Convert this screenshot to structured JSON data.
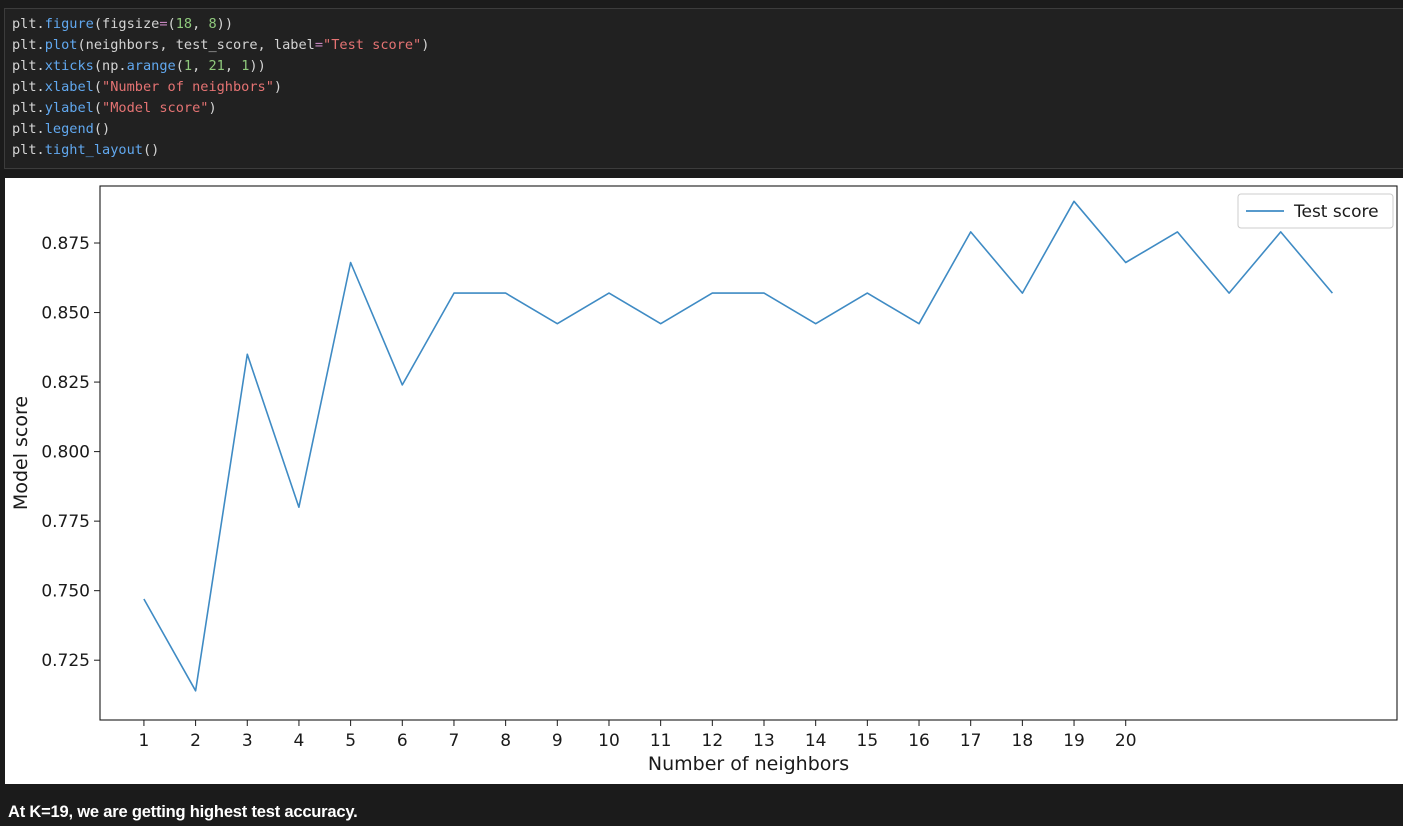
{
  "code_cell": {
    "lines": [
      [
        {
          "t": "plt.",
          "c": ""
        },
        {
          "t": "figure",
          "c": "fn"
        },
        {
          "t": "(figsize",
          "c": ""
        },
        {
          "t": "=",
          "c": "eq"
        },
        {
          "t": "(",
          "c": ""
        },
        {
          "t": "18",
          "c": "num"
        },
        {
          "t": ", ",
          "c": ""
        },
        {
          "t": "8",
          "c": "num"
        },
        {
          "t": "))",
          "c": ""
        }
      ],
      [
        {
          "t": "plt.",
          "c": ""
        },
        {
          "t": "plot",
          "c": "fn"
        },
        {
          "t": "(neighbors, test_score, label",
          "c": ""
        },
        {
          "t": "=",
          "c": "eq"
        },
        {
          "t": "\"Test score\"",
          "c": "str"
        },
        {
          "t": ")",
          "c": ""
        }
      ],
      [
        {
          "t": "plt.",
          "c": ""
        },
        {
          "t": "xticks",
          "c": "fn"
        },
        {
          "t": "(np.",
          "c": ""
        },
        {
          "t": "arange",
          "c": "fn"
        },
        {
          "t": "(",
          "c": ""
        },
        {
          "t": "1",
          "c": "num"
        },
        {
          "t": ", ",
          "c": ""
        },
        {
          "t": "21",
          "c": "num"
        },
        {
          "t": ", ",
          "c": ""
        },
        {
          "t": "1",
          "c": "num"
        },
        {
          "t": "))",
          "c": ""
        }
      ],
      [
        {
          "t": "plt.",
          "c": ""
        },
        {
          "t": "xlabel",
          "c": "fn"
        },
        {
          "t": "(",
          "c": ""
        },
        {
          "t": "\"Number of neighbors\"",
          "c": "str"
        },
        {
          "t": ")",
          "c": ""
        }
      ],
      [
        {
          "t": "plt.",
          "c": ""
        },
        {
          "t": "ylabel",
          "c": "fn"
        },
        {
          "t": "(",
          "c": ""
        },
        {
          "t": "\"Model score\"",
          "c": "str"
        },
        {
          "t": ")",
          "c": ""
        }
      ],
      [
        {
          "t": "plt.",
          "c": ""
        },
        {
          "t": "legend",
          "c": "fn"
        },
        {
          "t": "()",
          "c": ""
        }
      ],
      [
        {
          "t": "plt.",
          "c": ""
        },
        {
          "t": "tight_layout",
          "c": "fn"
        },
        {
          "t": "()",
          "c": ""
        }
      ]
    ]
  },
  "chart_data": {
    "type": "line",
    "title": "",
    "xlabel": "Number of neighbors",
    "ylabel": "Model score",
    "xlim": [
      0.15,
      25.25
    ],
    "ylim": [
      0.7035,
      0.8955
    ],
    "x_ticks": [
      1,
      2,
      3,
      4,
      5,
      6,
      7,
      8,
      9,
      10,
      11,
      12,
      13,
      14,
      15,
      16,
      17,
      18,
      19,
      20
    ],
    "y_ticks": [
      0.725,
      0.75,
      0.775,
      0.8,
      0.825,
      0.85,
      0.875
    ],
    "y_tick_labels": [
      "0.725",
      "0.750",
      "0.775",
      "0.800",
      "0.825",
      "0.850",
      "0.875"
    ],
    "grid": false,
    "legend_position": "top-right",
    "series": [
      {
        "name": "Test score",
        "color": "#3f8bc4",
        "x": [
          1,
          2,
          3,
          4,
          5,
          6,
          7,
          8,
          9,
          10,
          11,
          12,
          13,
          14,
          15,
          16,
          17,
          18,
          19,
          20,
          21,
          22,
          23,
          24
        ],
        "values": [
          0.747,
          0.714,
          0.835,
          0.78,
          0.868,
          0.824,
          0.857,
          0.857,
          0.846,
          0.857,
          0.846,
          0.857,
          0.857,
          0.846,
          0.857,
          0.846,
          0.879,
          0.857,
          0.89,
          0.868,
          0.879,
          0.857,
          0.879,
          0.857
        ]
      }
    ]
  },
  "markdown": {
    "text": "At K=19, we are getting highest test accuracy."
  }
}
